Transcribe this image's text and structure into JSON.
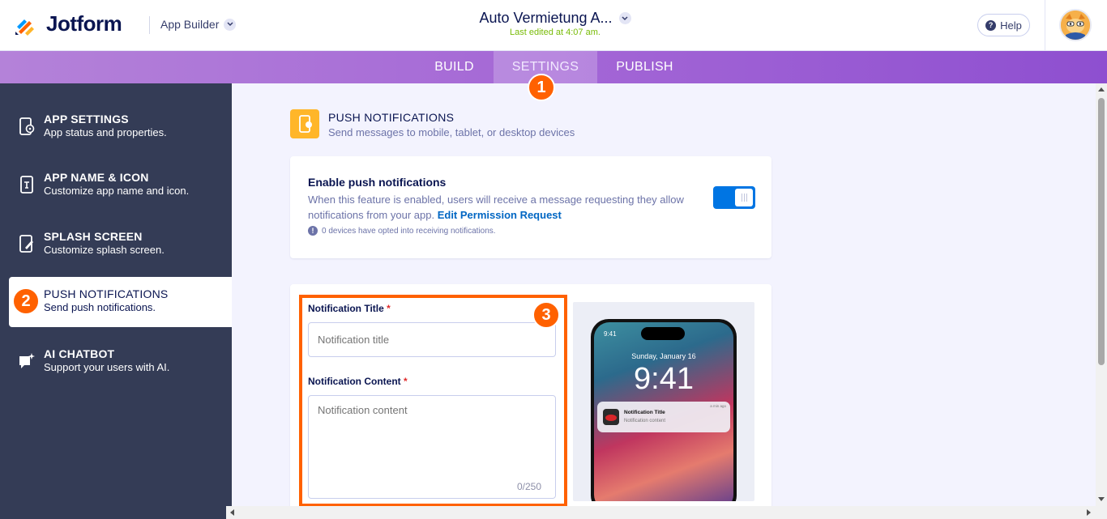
{
  "header": {
    "logo_text": "Jotform",
    "app_builder_label": "App Builder",
    "app_title": "Auto Vermietung A...",
    "last_edited": "Last edited at 4:07 am.",
    "help_label": "Help"
  },
  "nav": {
    "tabs": [
      {
        "label": "BUILD",
        "active": false
      },
      {
        "label": "SETTINGS",
        "active": true
      },
      {
        "label": "PUBLISH",
        "active": false
      }
    ]
  },
  "badges": [
    "1",
    "2",
    "3"
  ],
  "sidebar": {
    "items": [
      {
        "title": "APP SETTINGS",
        "desc": "App status and properties.",
        "icon": "phone-gear-icon"
      },
      {
        "title": "APP NAME & ICON",
        "desc": "Customize app name and icon.",
        "icon": "phone-text-icon"
      },
      {
        "title": "SPLASH SCREEN",
        "desc": "Customize splash screen.",
        "icon": "phone-brush-icon"
      },
      {
        "title": "PUSH NOTIFICATIONS",
        "desc": "Send push notifications.",
        "icon": "bell-icon",
        "active": true
      },
      {
        "title": "AI CHATBOT",
        "desc": "Support your users with AI.",
        "icon": "chat-sparkle-icon"
      }
    ]
  },
  "section": {
    "title": "PUSH NOTIFICATIONS",
    "desc": "Send messages to mobile, tablet, or desktop devices"
  },
  "enable_card": {
    "title": "Enable push notifications",
    "text": "When this feature is enabled, users will receive a message requesting they allow notifications from your app.",
    "link": "Edit Permission Request",
    "note": "0 devices have opted into receiving notifications.",
    "toggle_on": true
  },
  "form": {
    "title_label": "Notification Title",
    "title_placeholder": "Notification title",
    "content_label": "Notification Content",
    "content_placeholder": "Notification content",
    "counter": "0/250",
    "required_mark": "*"
  },
  "preview": {
    "status_time": "9:41",
    "date": "Sunday, January 16",
    "clock": "9:41",
    "notif_title": "Notification Title",
    "notif_content": "Notification content",
    "notif_ago": "a min ago"
  },
  "colors": {
    "accent_orange": "#ff6100",
    "nav_purple": "#a467d6",
    "sidebar_bg": "#343c56",
    "toggle_blue": "#0075e3",
    "last_edited_green": "#78bb07"
  }
}
